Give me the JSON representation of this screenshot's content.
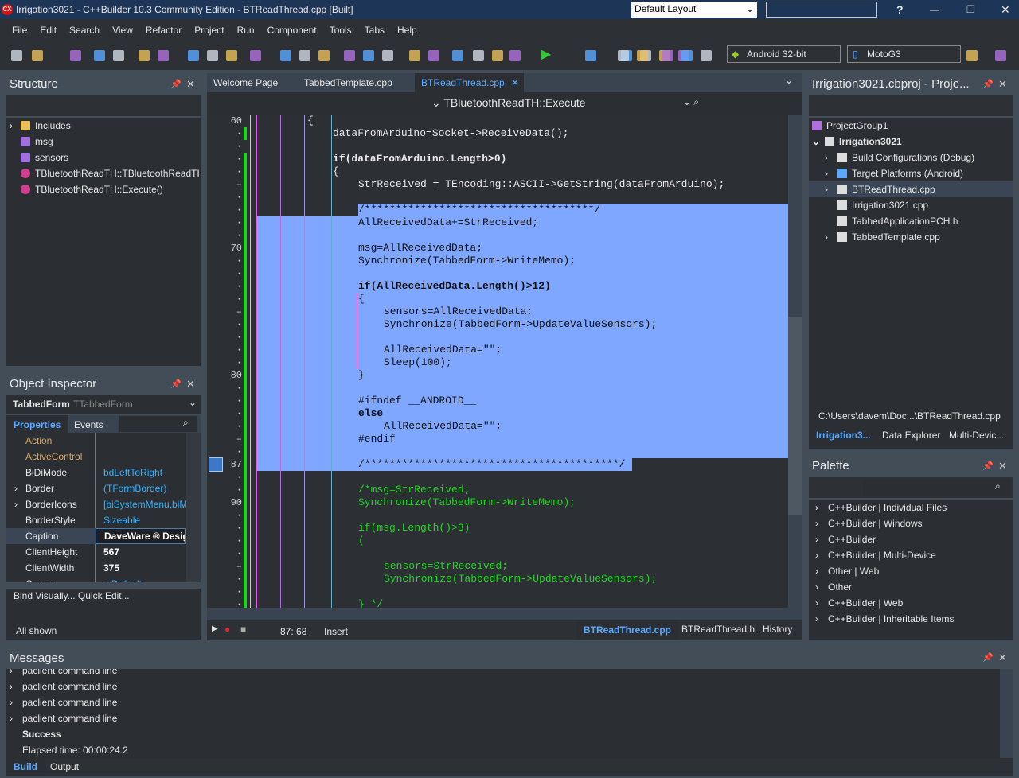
{
  "window": {
    "title": "Irrigation3021 - C++Builder 10.3 Community Edition - BTReadThread.cpp [Built]",
    "layout": "Default Layout",
    "help": "?"
  },
  "menu": [
    "File",
    "Edit",
    "Search",
    "View",
    "Refactor",
    "Project",
    "Run",
    "Component",
    "Tools",
    "Tabs",
    "Help"
  ],
  "toolbar": {
    "platform": "Android 32-bit",
    "device": "MotoG3"
  },
  "structure": {
    "title": "Structure",
    "items": [
      {
        "label": "Includes",
        "icon": "folder-icon"
      },
      {
        "label": "msg",
        "icon": "field-icon"
      },
      {
        "label": "sensors",
        "icon": "field-icon"
      },
      {
        "label": "TBluetoothReadTH::TBluetoothReadTH(",
        "icon": "method-icon"
      },
      {
        "label": "TBluetoothReadTH::Execute()",
        "icon": "method-icon"
      }
    ]
  },
  "inspector": {
    "title": "Object Inspector",
    "object": "TabbedForm",
    "type": "TTabbedForm",
    "tabs": [
      "Properties",
      "Events"
    ],
    "props": [
      {
        "name": "Action",
        "value": "",
        "style": "event"
      },
      {
        "name": "ActiveControl",
        "value": "",
        "style": "event"
      },
      {
        "name": "BiDiMode",
        "value": "bdLeftToRight",
        "style": "link"
      },
      {
        "name": "Border",
        "value": "(TFormBorder)",
        "style": "link",
        "expand": true
      },
      {
        "name": "BorderIcons",
        "value": "[biSystemMenu,biMinimize]",
        "style": "link",
        "expand": true
      },
      {
        "name": "BorderStyle",
        "value": "Sizeable",
        "style": "link"
      },
      {
        "name": "Caption",
        "value": "DaveWare ® Design",
        "style": "edit"
      },
      {
        "name": "ClientHeight",
        "value": "567",
        "style": "bold"
      },
      {
        "name": "ClientWidth",
        "value": "375",
        "style": "bold"
      },
      {
        "name": "Cursor",
        "value": "crDefault",
        "style": "link"
      }
    ],
    "actions": "Bind Visually...  Quick Edit...",
    "status": "All shown"
  },
  "editor": {
    "tabs": [
      "Welcome Page",
      "TabbedTemplate.cpp",
      "BTReadThread.cpp"
    ],
    "active_tab": 2,
    "method": "TBluetoothReadTH::Execute",
    "first_line": 60,
    "line_numbers": {
      "60": "60",
      "70": "70",
      "80": "80",
      "87": "87",
      "90": "90"
    },
    "lines": [
      [
        "{",
        0
      ],
      [
        "dataFromArduino=Socket->ReceiveData();",
        1
      ],
      [
        "",
        0
      ],
      [
        "if(dataFromArduino.Length>0)",
        1
      ],
      [
        "{",
        1
      ],
      [
        "StrReceived = TEncoding::ASCII->GetString(dataFromArduino);",
        2
      ],
      [
        "",
        0
      ],
      [
        "/*************************************/",
        2
      ],
      [
        "AllReceivedData+=StrReceived;",
        2
      ],
      [
        "",
        0
      ],
      [
        "msg=AllReceivedData;",
        2
      ],
      [
        "Synchronize(TabbedForm->WriteMemo);",
        2
      ],
      [
        "",
        0
      ],
      [
        "if(AllReceivedData.Length()>12)",
        2
      ],
      [
        "{",
        2
      ],
      [
        "sensors=AllReceivedData;",
        3
      ],
      [
        "Synchronize(TabbedForm->UpdateValueSensors);",
        3
      ],
      [
        "",
        0
      ],
      [
        "AllReceivedData=\"\";",
        3
      ],
      [
        "Sleep(100);",
        3
      ],
      [
        "}",
        2
      ],
      [
        "",
        0
      ],
      [
        "#ifndef __ANDROID__",
        2
      ],
      [
        "else",
        2
      ],
      [
        "AllReceivedData=\"\";",
        3
      ],
      [
        "#endif",
        2
      ],
      [
        "",
        0
      ],
      [
        "/*****************************************/",
        2
      ],
      [
        "",
        0
      ],
      [
        "/*msg=StrReceived;",
        2
      ],
      [
        "Synchronize(TabbedForm->WriteMemo);",
        2
      ],
      [
        "",
        0
      ],
      [
        "if(msg.Length()>3)",
        2
      ],
      [
        "(",
        2
      ],
      [
        "",
        0
      ],
      [
        "sensors=StrReceived;",
        3
      ],
      [
        "Synchronize(TabbedForm->UpdateValueSensors);",
        3
      ],
      [
        "",
        0
      ],
      [
        "} */",
        2
      ]
    ],
    "status": {
      "position": "87: 68",
      "mode": "Insert"
    },
    "bottom_tabs": [
      "BTReadThread.cpp",
      "BTReadThread.h",
      "History"
    ]
  },
  "project": {
    "title": "Irrigation3021.cbproj - Proje...",
    "items": [
      {
        "label": "ProjectGroup1",
        "level": 0
      },
      {
        "label": "Irrigation3021",
        "level": 1,
        "bold": true
      },
      {
        "label": "Build Configurations (Debug)",
        "level": 2
      },
      {
        "label": "Target Platforms (Android)",
        "level": 2
      },
      {
        "label": "BTReadThread.cpp",
        "level": 2,
        "selected": true
      },
      {
        "label": "Irrigation3021.cpp",
        "level": 2
      },
      {
        "label": "TabbedApplicationPCH.h",
        "level": 2
      },
      {
        "label": "TabbedTemplate.cpp",
        "level": 2
      }
    ],
    "path": "C:\\Users\\davem\\Doc...\\BTReadThread.cpp",
    "tabs": [
      "Irrigation3...",
      "Data Explorer",
      "Multi-Devic..."
    ]
  },
  "palette": {
    "title": "Palette",
    "items": [
      "C++Builder | Individual Files",
      "C++Builder | Windows",
      "C++Builder",
      "C++Builder | Multi-Device",
      "Other | Web",
      "Other",
      "C++Builder | Web",
      "C++Builder | Inheritable Items"
    ]
  },
  "messages": {
    "title": "Messages",
    "items": [
      "paclient command line",
      "paclient command line",
      "paclient command line",
      "paclient command line"
    ],
    "success": "Success",
    "elapsed": "Elapsed time: 00:00:24.2",
    "tabs": [
      "Build",
      "Output"
    ]
  },
  "colors": {
    "selection": "#7fa7ff",
    "accent": "#5aa9ff",
    "gutter_modified": "#19d919"
  }
}
